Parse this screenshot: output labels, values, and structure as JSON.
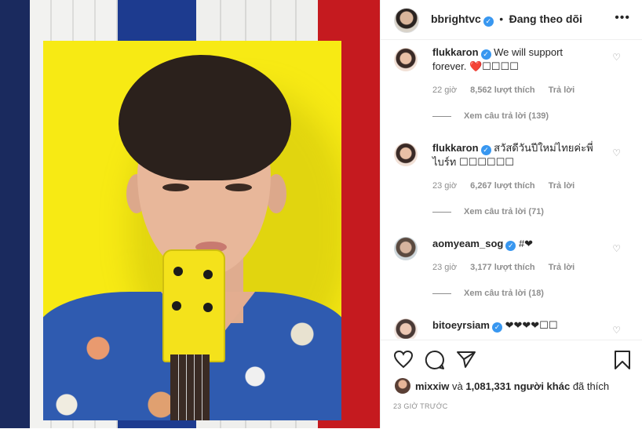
{
  "header": {
    "username": "bbrightvc",
    "separator": "•",
    "follow_label": "Đang theo dõi",
    "more_icon": "more-horizontal-icon"
  },
  "comments": [
    {
      "username": "flukkaron",
      "text": "We will support forever. ❤️☐☐☐☐",
      "time": "22 giờ",
      "likes": "8,562 lượt thích",
      "reply": "Trả lời",
      "view_replies": "Xem câu trả lời (139)"
    },
    {
      "username": "flukkaron",
      "text": "สวัสดีวันปีใหม่ไทยค่ะพี่ไบร์ท ☐☐☐☐☐☐",
      "time": "23 giờ",
      "likes": "6,267 lượt thích",
      "reply": "Trả lời",
      "view_replies": "Xem câu trả lời (71)"
    },
    {
      "username": "aomyeam_sog",
      "text": "#❤",
      "time": "23 giờ",
      "likes": "3,177 lượt thích",
      "reply": "Trả lời",
      "view_replies": "Xem câu trả lời (18)"
    },
    {
      "username": "bitoeyrsiam",
      "text": "❤❤❤❤☐☐"
    }
  ],
  "actions": {
    "like_icon": "heart-icon",
    "comment_icon": "comment-icon",
    "share_icon": "send-icon",
    "save_icon": "bookmark-icon"
  },
  "likes": {
    "first_user": "mixxiw",
    "connector": "và",
    "others": "1,081,331 người khác",
    "suffix": "đã thích"
  },
  "time_ago": "23 GIỜ TRƯỚC",
  "colors": {
    "verified": "#3897f0",
    "meta_gray": "#8e8e8e",
    "text": "#262626",
    "photo_yellow": "#f7ea14",
    "stripe_red": "#c51a1f",
    "stripe_blue": "#1d3b8f"
  }
}
